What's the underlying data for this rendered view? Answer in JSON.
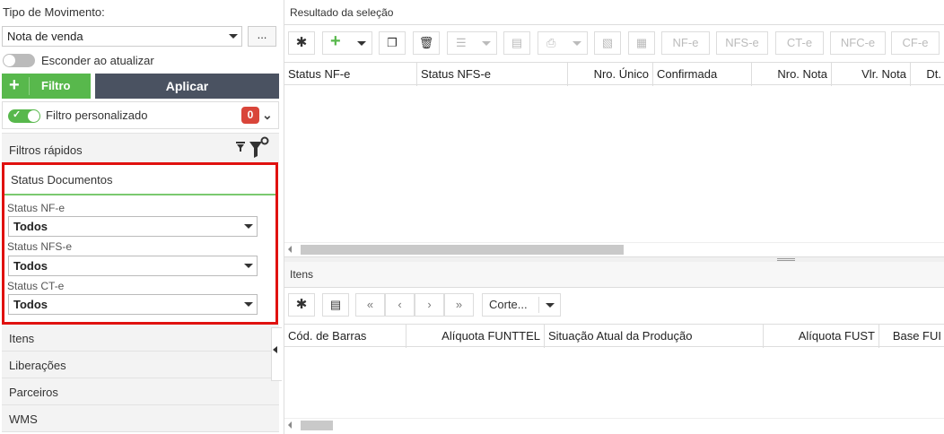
{
  "left": {
    "tipo_label": "Tipo de Movimento:",
    "tipo_value": "Nota de venda",
    "tipo_more": "...",
    "esconder_label": "Esconder ao atualizar",
    "filtro_label": "Filtro",
    "aplicar_label": "Aplicar",
    "filtro_personalizado_label": "Filtro personalizado",
    "filtro_personalizado_count": "0",
    "filtros_rapidos_label": "Filtros rápidos",
    "status_section": {
      "title": "Status Documentos",
      "fields": [
        {
          "label": "Status NF-e",
          "value": "Todos"
        },
        {
          "label": "Status NFS-e",
          "value": "Todos"
        },
        {
          "label": "Status CT-e",
          "value": "Todos"
        }
      ]
    },
    "accordion": [
      "Itens",
      "Liberações",
      "Parceiros",
      "WMS"
    ]
  },
  "right": {
    "resultado_title": "Resultado da seleção",
    "toolbar_text_buttons": [
      "NF-e",
      "NFS-e",
      "CT-e",
      "NFC-e",
      "CF-e"
    ],
    "grid_columns": [
      "Status NF-e",
      "Status NFS-e",
      "Nro. Único",
      "Confirmada",
      "Nro. Nota",
      "Vlr. Nota",
      "Dt."
    ],
    "itens_title": "Itens",
    "itens_toolbar": {
      "corte_label": "Corte..."
    },
    "itens_columns": [
      "Cód. de Barras",
      "Alíquota FUNTTEL",
      "Situação Atual da Produção",
      "Alíquota FUST",
      "Base FUI"
    ]
  },
  "colors": {
    "green": "#58b84c",
    "dark": "#4a5261",
    "red_highlight": "#e0110f",
    "badge_red": "#d9453a"
  }
}
